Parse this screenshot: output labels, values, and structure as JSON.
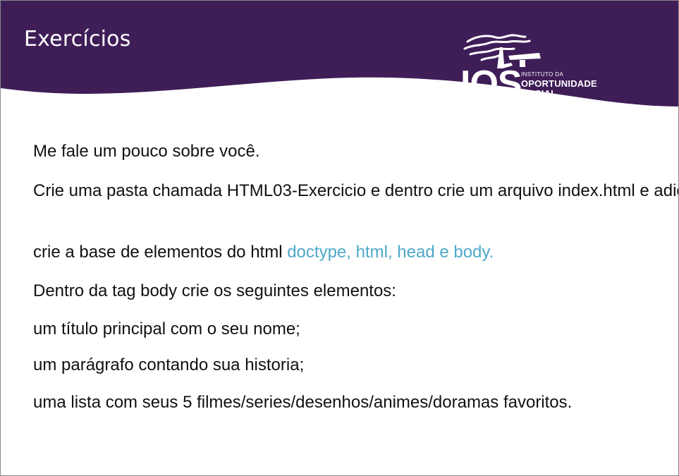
{
  "slide": {
    "title": "Exercícios",
    "header_color": "#3f1e58",
    "accent_color": "#4ea8c9"
  },
  "logo": {
    "icon": "tree-icon",
    "acronym": "IOS",
    "line1": "INSTITUTO DA",
    "line2": "OPORTUNIDADE",
    "line3": "SOCIAL"
  },
  "content": {
    "line1": "Me fale um pouco sobre você.",
    "line2": "Crie uma pasta chamada HTML03-Exercicio e dentro crie um arquivo index.html e adicione a seguintes informações.",
    "line3_text": "crie a base de elementos do html ",
    "line3_highlight": "doctype, html, head e body.",
    "line4": "Dentro da tag body crie os seguintes elementos:",
    "line5": "um título principal com o seu nome;",
    "line6": "um parágrafo contando sua historia;",
    "line7": "uma lista com seus 5 filmes/series/desenhos/animes/doramas favoritos."
  }
}
